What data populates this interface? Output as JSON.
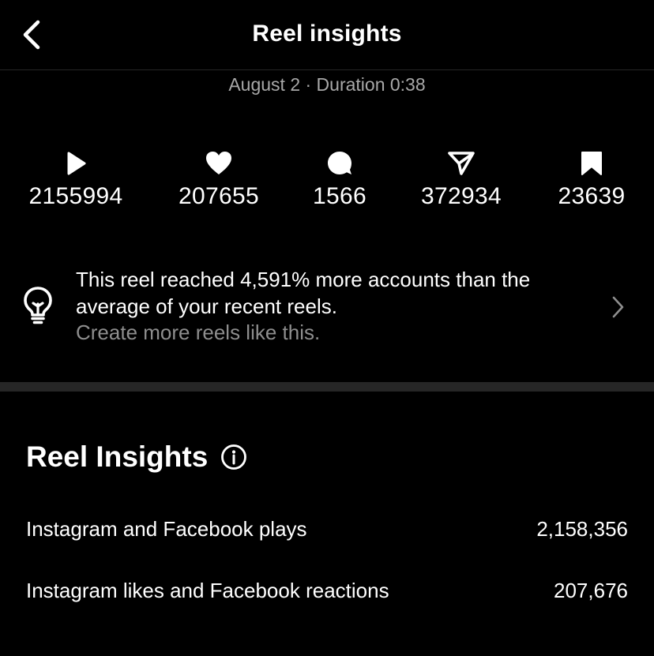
{
  "header": {
    "title": "Reel insights",
    "back_icon": "chevron-left-icon"
  },
  "meta": {
    "subtitle": "August 2 · Duration 0:38"
  },
  "stats": [
    {
      "icon": "play-icon",
      "value": "2155994"
    },
    {
      "icon": "heart-icon",
      "value": "207655"
    },
    {
      "icon": "comment-icon",
      "value": "1566"
    },
    {
      "icon": "share-icon",
      "value": "372934"
    },
    {
      "icon": "bookmark-icon",
      "value": "23639"
    }
  ],
  "tip": {
    "icon": "lightbulb-icon",
    "line1": "This reel reached 4,591% more accounts than the",
    "line2": "average of your recent reels.",
    "line3": "Create more reels like this.",
    "chevron_icon": "chevron-right-icon"
  },
  "insights": {
    "title": "Reel Insights",
    "info_icon": "info-icon",
    "rows": [
      {
        "label": "Instagram and Facebook plays",
        "value": "2,158,356"
      },
      {
        "label": "Instagram likes and Facebook reactions",
        "value": "207,676"
      }
    ]
  },
  "colors": {
    "background": "#000000",
    "text": "#ffffff",
    "secondary_text": "#a8a8a8",
    "divider": "#262626"
  }
}
